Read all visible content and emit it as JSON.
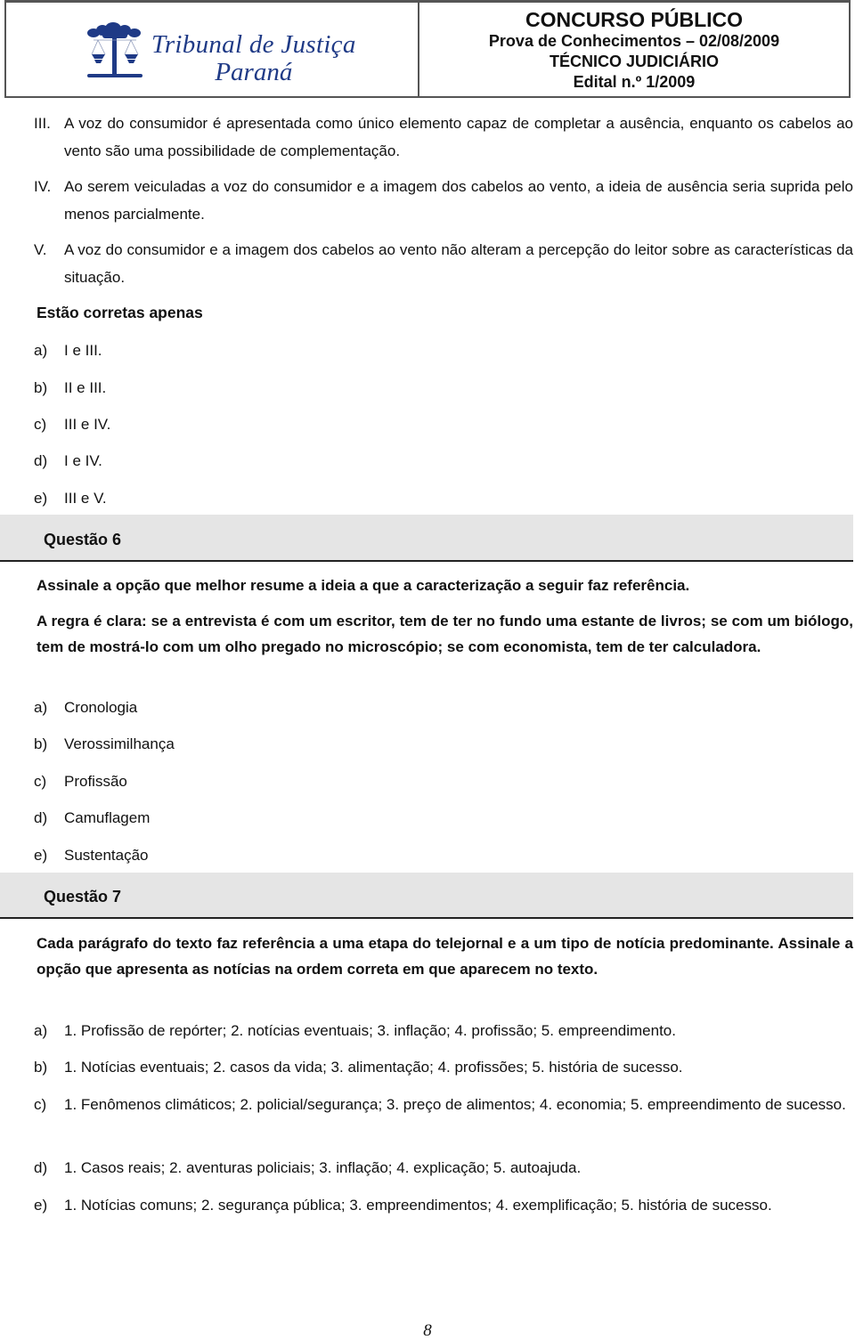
{
  "header": {
    "logo": {
      "icon": "scales-of-justice-tree-icon",
      "line1": "Tribunal de Justiça",
      "line2": "Paraná",
      "color": "#1f3a86"
    },
    "title": "CONCURSO PÚBLICO",
    "exam": "Prova de Conhecimentos – 02/08/2009",
    "role": "TÉCNICO JUDICIÁRIO",
    "edital": "Edital n.º 1/2009"
  },
  "q5": {
    "statements": [
      {
        "num": "III.",
        "text": "A voz do consumidor é apresentada como único elemento capaz de completar a ausência, enquanto os cabelos ao vento são uma possibilidade de complementação."
      },
      {
        "num": "IV.",
        "text": "Ao serem veiculadas a voz do consumidor e a imagem dos cabelos ao vento, a ideia de ausência seria suprida pelo menos parcialmente."
      },
      {
        "num": "V.",
        "text": "A voz do consumidor e a imagem dos cabelos ao vento não alteram a percepção do leitor sobre as características da situação."
      }
    ],
    "prompt": "Estão corretas apenas",
    "options": [
      {
        "letter": "a)",
        "text": "I e III."
      },
      {
        "letter": "b)",
        "text": "II e III."
      },
      {
        "letter": "c)",
        "text": "III e IV."
      },
      {
        "letter": "d)",
        "text": "I e IV."
      },
      {
        "letter": "e)",
        "text": "III e V."
      }
    ]
  },
  "q6": {
    "title": "Questão 6",
    "instruction": "Assinale a opção que melhor resume a ideia a que a caracterização a seguir faz referência.",
    "quote": "A regra é clara: se a entrevista é com um escritor, tem de ter no fundo uma estante de livros; se com um biólogo, tem de mostrá-lo com um olho pregado no microscópio; se com economista, tem de ter calculadora.",
    "options": [
      {
        "letter": "a)",
        "text": "Cronologia"
      },
      {
        "letter": "b)",
        "text": "Verossimilhança"
      },
      {
        "letter": "c)",
        "text": "Profissão"
      },
      {
        "letter": "d)",
        "text": "Camuflagem"
      },
      {
        "letter": "e)",
        "text": "Sustentação"
      }
    ]
  },
  "q7": {
    "title": "Questão 7",
    "instruction": "Cada parágrafo do texto faz referência a uma etapa do telejornal e a um tipo de notícia predominante. Assinale a opção que apresenta as notícias na ordem correta em que aparecem no texto.",
    "options": [
      {
        "letter": "a)",
        "text": "1. Profissão de repórter; 2. notícias eventuais; 3. inflação; 4. profissão; 5. empreendimento."
      },
      {
        "letter": "b)",
        "text": "1. Notícias eventuais; 2. casos da vida; 3. alimentação; 4. profissões; 5. história de sucesso."
      },
      {
        "letter": "c)",
        "text": "1. Fenômenos climáticos; 2. policial/segurança; 3. preço de alimentos; 4. economia; 5. empreendimento de sucesso."
      },
      {
        "letter": "d)",
        "text": "1. Casos reais; 2. aventuras policiais; 3. inflação; 4. explicação; 5. autoajuda."
      },
      {
        "letter": "e)",
        "text": "1. Notícias comuns; 2. segurança pública; 3. empreendimentos; 4. exemplificação; 5. história de sucesso."
      }
    ]
  },
  "footer": {
    "page_number": "8"
  }
}
